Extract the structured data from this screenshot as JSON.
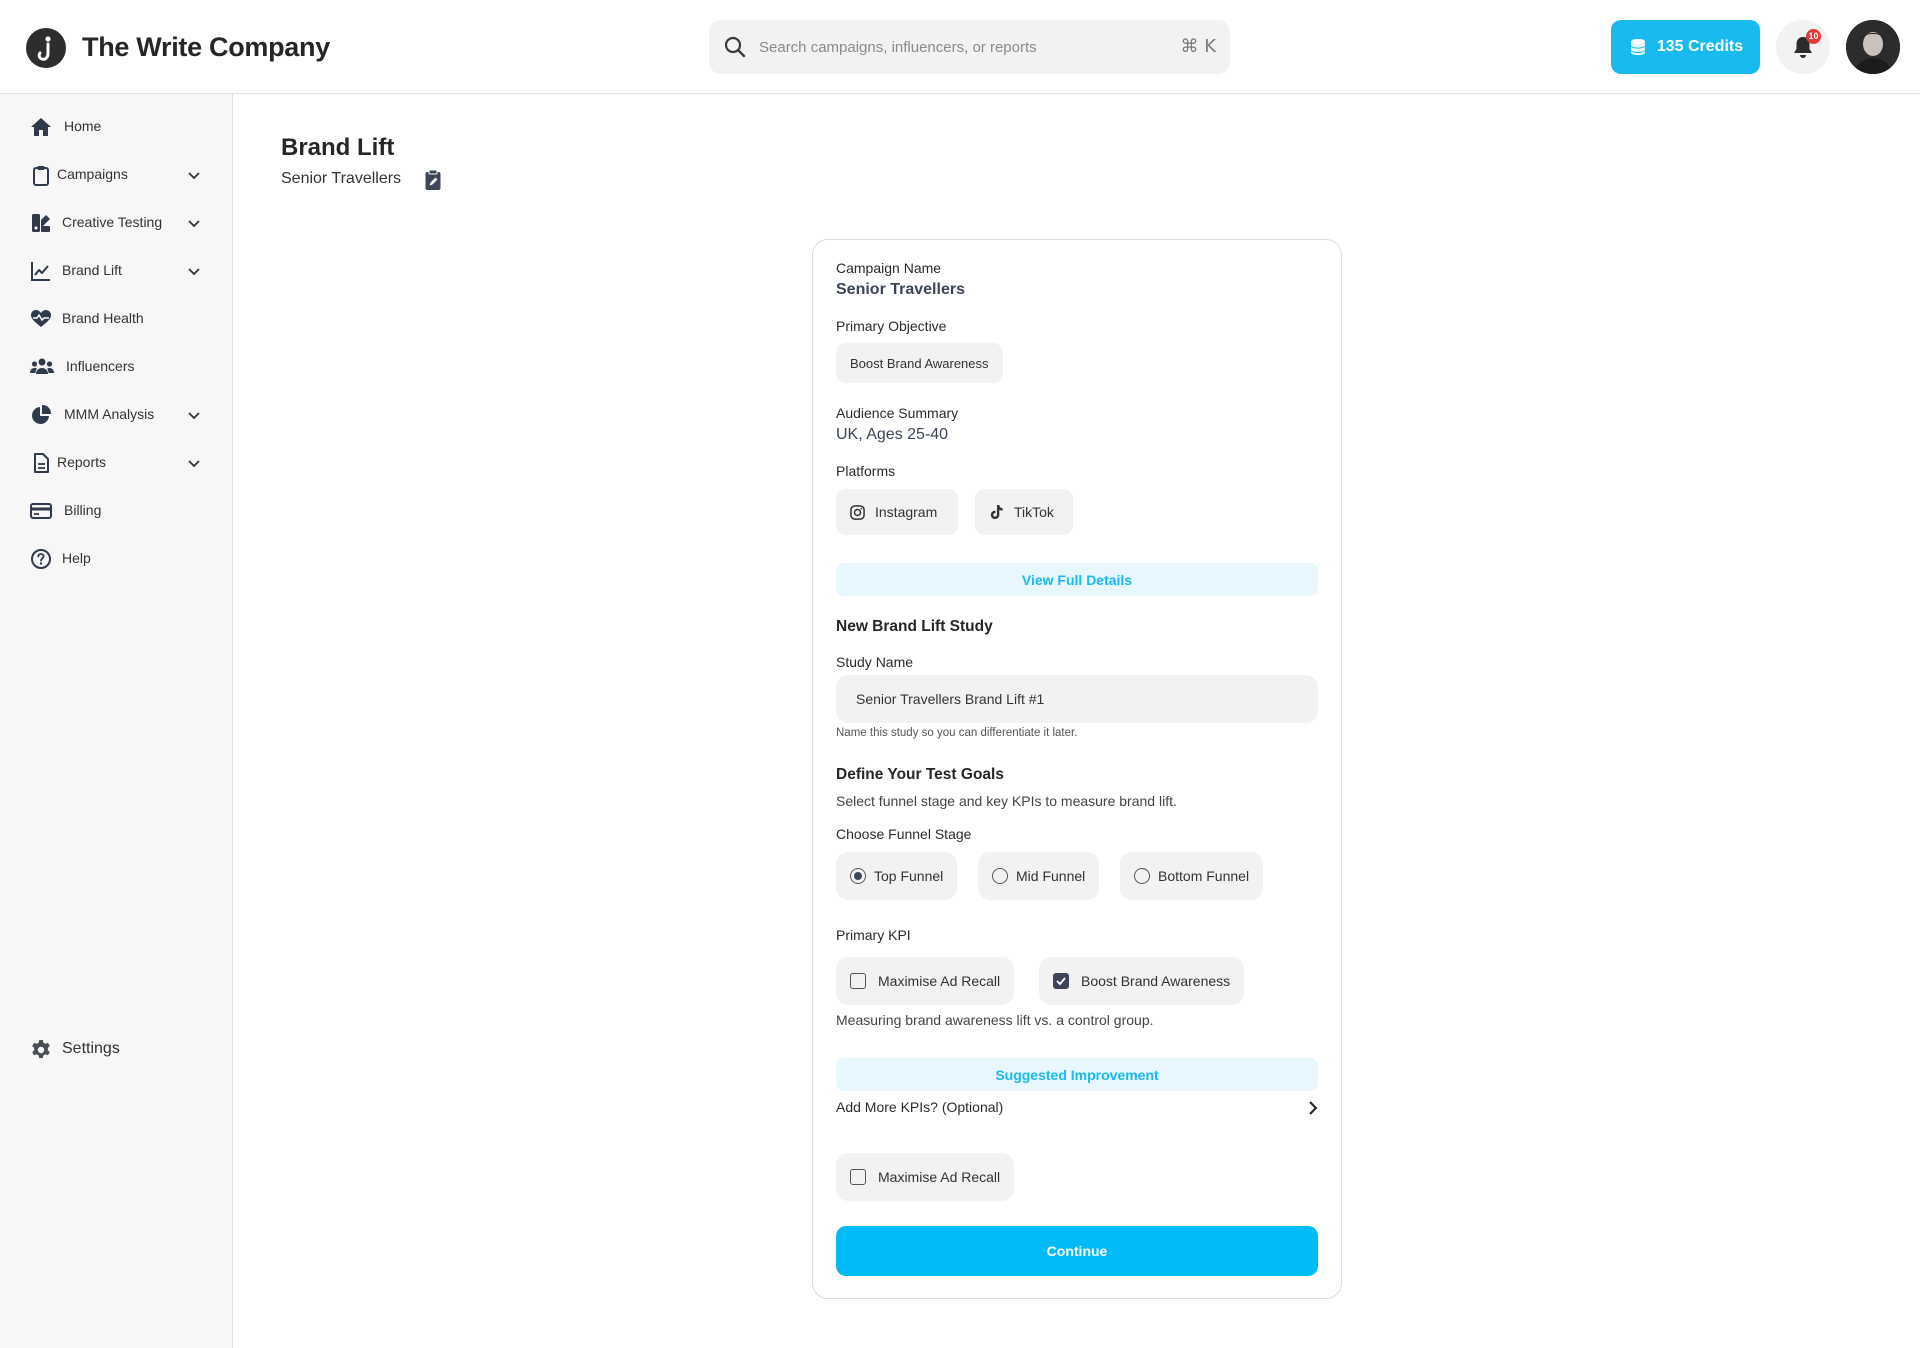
{
  "app": {
    "title": "The Write Company"
  },
  "header": {
    "search_placeholder": "Search campaigns, influencers, or reports",
    "search_shortcut": "⌘ K",
    "credits_label": "135 Credits",
    "notification_count": "10"
  },
  "sidebar": {
    "items": [
      {
        "label": "Home",
        "icon": "home-icon",
        "expandable": false
      },
      {
        "label": "Campaigns",
        "icon": "clipboard-icon",
        "expandable": true
      },
      {
        "label": "Creative Testing",
        "icon": "creative-testing-icon",
        "expandable": true
      },
      {
        "label": "Brand Lift",
        "icon": "line-chart-icon",
        "expandable": true
      },
      {
        "label": "Brand Health",
        "icon": "heart-pulse-icon",
        "expandable": false
      },
      {
        "label": "Influencers",
        "icon": "users-icon",
        "expandable": false
      },
      {
        "label": "MMM Analysis",
        "icon": "pie-chart-icon",
        "expandable": true
      },
      {
        "label": "Reports",
        "icon": "document-icon",
        "expandable": true
      },
      {
        "label": "Billing",
        "icon": "credit-card-icon",
        "expandable": false
      },
      {
        "label": "Help",
        "icon": "help-circle-icon",
        "expandable": false
      }
    ],
    "settings_label": "Settings"
  },
  "page": {
    "title": "Brand Lift",
    "subtitle": "Senior Travellers"
  },
  "card": {
    "campaign_name_label": "Campaign Name",
    "campaign_name": "Senior Travellers",
    "primary_objective_label": "Primary Objective",
    "primary_objective": "Boost Brand Awareness",
    "audience_summary_label": "Audience Summary",
    "audience_summary": "UK, Ages 25-40",
    "platforms_label": "Platforms",
    "platforms": [
      "Instagram",
      "TikTok"
    ],
    "view_details_label": "View Full Details",
    "new_study_heading": "New Brand Lift Study",
    "study_name_label": "Study Name",
    "study_name_value": "Senior Travellers Brand Lift #1",
    "study_name_help": "Name this study so you can differentiate it later.",
    "goals_heading": "Define Your Test Goals",
    "goals_description": "Select funnel stage and key KPIs to measure brand lift.",
    "funnel_label": "Choose Funnel Stage",
    "funnel_options": [
      {
        "label": "Top Funnel",
        "selected": true
      },
      {
        "label": "Mid Funnel",
        "selected": false
      },
      {
        "label": "Bottom Funnel",
        "selected": false
      }
    ],
    "primary_kpi_label": "Primary KPI",
    "primary_kpi_options": [
      {
        "label": "Maximise Ad Recall",
        "checked": false
      },
      {
        "label": "Boost Brand Awareness",
        "checked": true
      }
    ],
    "kpi_note": "Measuring brand awareness lift vs. a control group.",
    "suggested_label": "Suggested Improvement",
    "more_kpis_label": "Add More KPIs? (Optional)",
    "more_kpi_options": [
      {
        "label": "Maximise Ad Recall",
        "checked": false
      }
    ],
    "continue_label": "Continue"
  },
  "colors": {
    "accent": "#00bbf5",
    "accent_light": "#e8f7fd",
    "text_dark": "#262626",
    "value_text": "#3c4658",
    "badge": "#e53935"
  }
}
